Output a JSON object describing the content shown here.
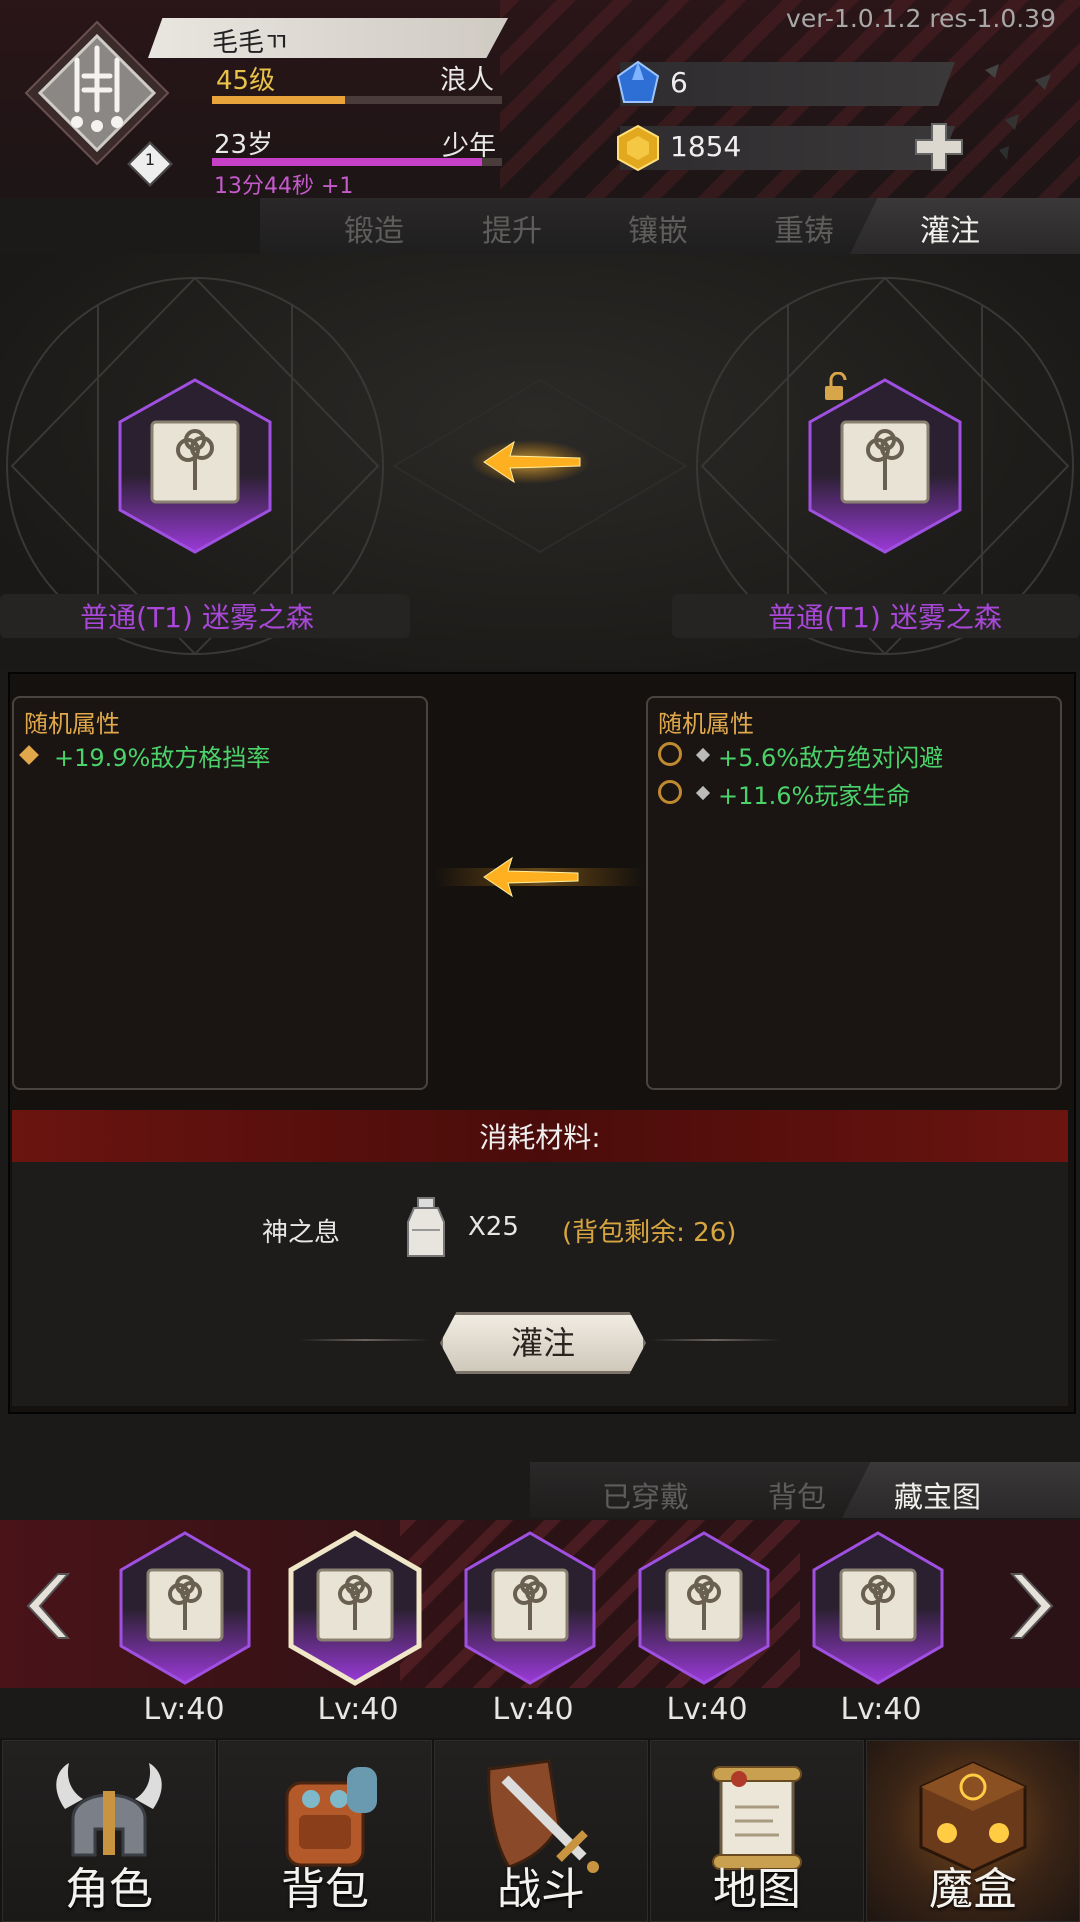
{
  "version": "ver-1.0.1.2   res-1.0.39",
  "player": {
    "name": "毛毛ㄲ",
    "level": "45级",
    "class": "浪人",
    "level_progress": 0.46,
    "age": "23岁",
    "stage": "少年",
    "age_progress": 0.93,
    "timer": "13分44秒 +1",
    "badge": "1"
  },
  "resources": {
    "gems": "6",
    "gold": "1854"
  },
  "tabs": [
    "锻造",
    "提升",
    "镶嵌",
    "重铸",
    "灌注"
  ],
  "active_tab": "灌注",
  "items": {
    "left_name": "普通(T1) 迷雾之森",
    "right_name": "普通(T1) 迷雾之森"
  },
  "left_attrs": {
    "title": "随机属性",
    "lines": [
      "+19.9%敌方格挡率"
    ]
  },
  "right_attrs": {
    "title": "随机属性",
    "lines": [
      "+5.6%敌方绝对闪避",
      "+11.6%玩家生命"
    ]
  },
  "cost": {
    "title": "消耗材料:",
    "material_name": "神之息",
    "quantity": "X25",
    "remaining": "(背包剩余: 26)"
  },
  "infuse_button": "灌注",
  "lower_tabs": [
    "已穿戴",
    "背包",
    "藏宝图"
  ],
  "lower_active_tab": "藏宝图",
  "inventory": [
    {
      "level": "Lv:40"
    },
    {
      "level": "Lv:40"
    },
    {
      "level": "Lv:40"
    },
    {
      "level": "Lv:40"
    },
    {
      "level": "Lv:40"
    }
  ],
  "nav": [
    "角色",
    "背包",
    "战斗",
    "地图",
    "魔盒"
  ],
  "colors": {
    "rarity_purple": "#a847d8",
    "attr_green": "#4bd26a",
    "gold_text": "#e8c24a",
    "cost_bar": "#6b1410"
  },
  "icons": {
    "avatar": "dagger-trident-icon",
    "gem": "blue-gem-icon",
    "gold": "gold-coin-icon",
    "item": "treasure-map-icon",
    "arrow": "left-arrow-icon",
    "lock": "unlock-icon",
    "material": "potion-bottle-icon"
  }
}
